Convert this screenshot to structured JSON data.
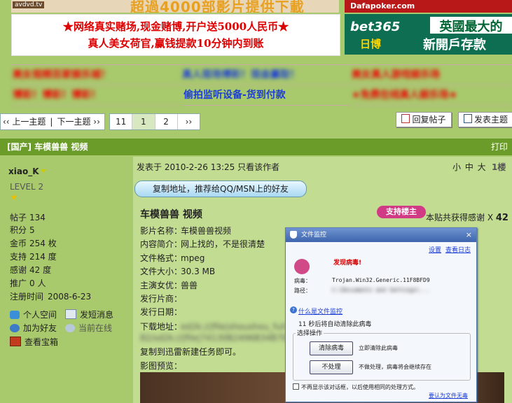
{
  "ads": {
    "top_left_brand": "avdvd.tv",
    "top_left_text": "超過4000部影片提供下載",
    "top_right_logo": "Dafapoker.com",
    "banner_line1": "★网络真实赌场,现金赌博,开户送5000人民币★",
    "banner_line2": "真人美女荷官,赢钱提款10分钟内到账",
    "bet_brand": "bet365",
    "bet_sub": "日博",
    "bet_title": "英國最大的",
    "bet_slogan": "新開戶存款",
    "grid": {
      "r1c1": "美女视频百家娱乐城！",
      "r1c2": "真人现场博彩！现金赢取！",
      "r1c3": "美女真人游戏娱乐场",
      "r2c1": "博彩！博彩！博彩！",
      "r2c2": "偷拍监听设备-货到付款",
      "r2c3": "★免费在线真人娱乐场★"
    }
  },
  "nav": {
    "prev_topic": "‹‹ 上一主题",
    "sep": "|",
    "next_topic": "下一主题 ››",
    "pages": [
      "11",
      "1",
      "2",
      "››"
    ],
    "reply_btn": "回复帖子",
    "new_topic_btn": "发表主题"
  },
  "thread": {
    "title": "[国产] 车模兽兽 视频",
    "print": "打印"
  },
  "author": {
    "name": "xiao_K",
    "level": "LEVEL 2",
    "star": "★",
    "stats": [
      {
        "k": "帖子",
        "v": "134"
      },
      {
        "k": "积分",
        "v": "5"
      },
      {
        "k": "金币",
        "v": "254 枚"
      },
      {
        "k": "支持",
        "v": "214 度"
      },
      {
        "k": "感谢",
        "v": "42 度"
      },
      {
        "k": "推广",
        "v": "0 人"
      },
      {
        "k": "注册时间",
        "v": "2008-6-23"
      }
    ],
    "actions": {
      "space": "个人空间",
      "message": "发短消息",
      "add_friend": "加为好友",
      "online": "当前在线",
      "treasure": "查看宝箱"
    }
  },
  "post": {
    "meta": "发表于 2010-2-26 13:25  只看该作者",
    "font_ctrl": "小 中 大",
    "floor": "1楼",
    "copy_addr": "复制地址，推荐给QQ/MSN上的好友",
    "title": "车模兽兽 视频",
    "thank_badge": "支持楼主",
    "thank_prefix": "本贴共获得感谢 X ",
    "thank_count": "42",
    "fields": [
      {
        "k": "影片名称：",
        "v": "车模兽兽视频"
      },
      {
        "k": "内容简介：",
        "v": "网上找的，不是很清楚"
      },
      {
        "k": "文件格式：",
        "v": "mpeg"
      },
      {
        "k": "文件大小：",
        "v": "30.3 MB"
      },
      {
        "k": "主演女优：",
        "v": "兽兽"
      },
      {
        "k": "发行片商：",
        "v": ""
      },
      {
        "k": "发行日期：",
        "v": ""
      }
    ],
    "download_label": "下载地址：",
    "download_blur": "ed2k://|file|shoushou_full.mpeg|31776686|7413E34947",
    "download_blur2": "82/sd2k://|file|74130B2496B34B7E/",
    "copy_hint": "复制到迅雷新建任务即可。",
    "preview_label": "影图预览："
  },
  "dialog": {
    "title": "文件监控",
    "settings": "设置",
    "view_log": "查看日志",
    "virus_found": "发现病毒!",
    "virus_label": "病毒：",
    "virus_name": "Trojan.Win32.Generic.11F8BFD9",
    "path_label": "路径：",
    "path_value": "C:\\Documents and Settings\\...",
    "what_is": "什么是文件监控",
    "countdown": "11  秒后将自动清除此病毒",
    "action_legend": "选择操作",
    "clean_btn": "清除病毒",
    "clean_note": "立即清除此病毒",
    "ignore_btn": "不处理",
    "ignore_note": "不做处理，病毒将会继续存在",
    "dont_show": "不再显示该对话框，以后使用相同的处理方式。",
    "trust": "要认为文件无毒"
  }
}
